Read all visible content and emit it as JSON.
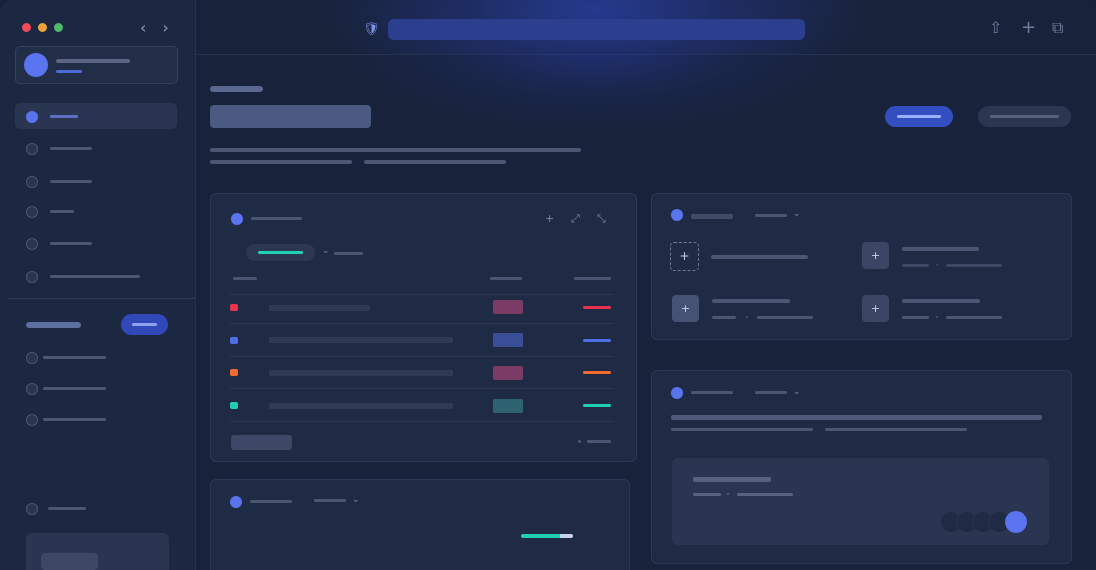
{
  "window": {
    "traffic_lights": {
      "close": "#ef4c58",
      "minimize": "#f2a23c",
      "maximize": "#4fba6a"
    },
    "nav": {
      "back": "‹",
      "forward": "›"
    }
  },
  "topbar": {
    "shield_icon": "🛡",
    "share_icon": "⇧",
    "new_tab_icon": "+",
    "tabs_icon": "⧉"
  },
  "colors": {
    "accent": "#5a74ef",
    "primary_button": "#334fbf",
    "red": "#e8334f",
    "blue": "#4f6fe8",
    "orange": "#f36a2e",
    "teal": "#1fd1b0"
  },
  "table_rows": [
    {
      "color": "#e8334f",
      "badge": "#7a3c64"
    },
    {
      "color": "#4f6fe8",
      "badge": "#3a4f98"
    },
    {
      "color": "#f36a2e",
      "badge": "#7a3c64"
    },
    {
      "color": "#1fd1b0",
      "badge": "#2f6270"
    }
  ],
  "icons": {
    "plus": "+",
    "expand": "⤢",
    "collapse": "⤡",
    "chevron": "⌄"
  }
}
